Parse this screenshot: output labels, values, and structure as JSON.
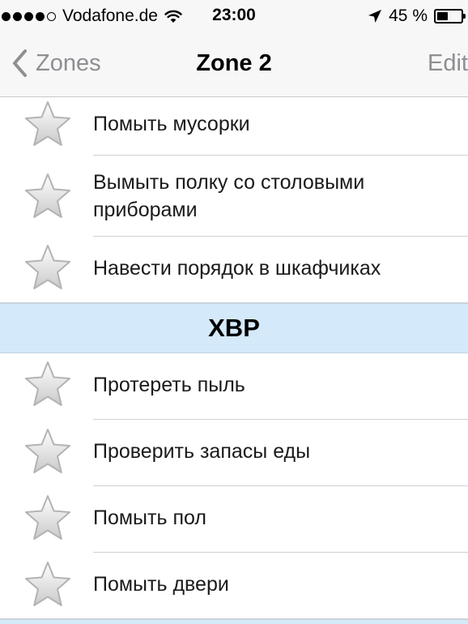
{
  "status_bar": {
    "signal_filled": 4,
    "signal_total": 5,
    "carrier": "Vodafone.de",
    "time": "23:00",
    "battery_percent": "45 %",
    "battery_level": 0.45
  },
  "nav": {
    "back_label": "Zones",
    "title": "Zone 2",
    "edit_label": "Edit"
  },
  "sections": [
    {
      "header": "",
      "tasks": [
        {
          "label": "Помыть мусорки",
          "starred": false
        },
        {
          "label": "Вымыть полку со столовыми приборами",
          "starred": false
        },
        {
          "label": "Навести порядок в шкафчиках",
          "starred": false
        }
      ]
    },
    {
      "header": "ХВР",
      "tasks": [
        {
          "label": "Протереть пыль",
          "starred": false
        },
        {
          "label": "Проверить запасы еды",
          "starred": false
        },
        {
          "label": "Помыть пол",
          "starred": false
        },
        {
          "label": "Помыть двери",
          "starred": false
        }
      ]
    }
  ],
  "icons": {
    "star": "star-outline-icon",
    "back": "chevron-left-icon",
    "wifi": "wifi-icon",
    "location": "location-arrow-icon",
    "battery": "battery-icon"
  },
  "colors": {
    "section_header_bg": "#d4e9f9",
    "nav_bar_bg": "#f7f7f7",
    "nav_text_gray": "#8e8e93"
  }
}
